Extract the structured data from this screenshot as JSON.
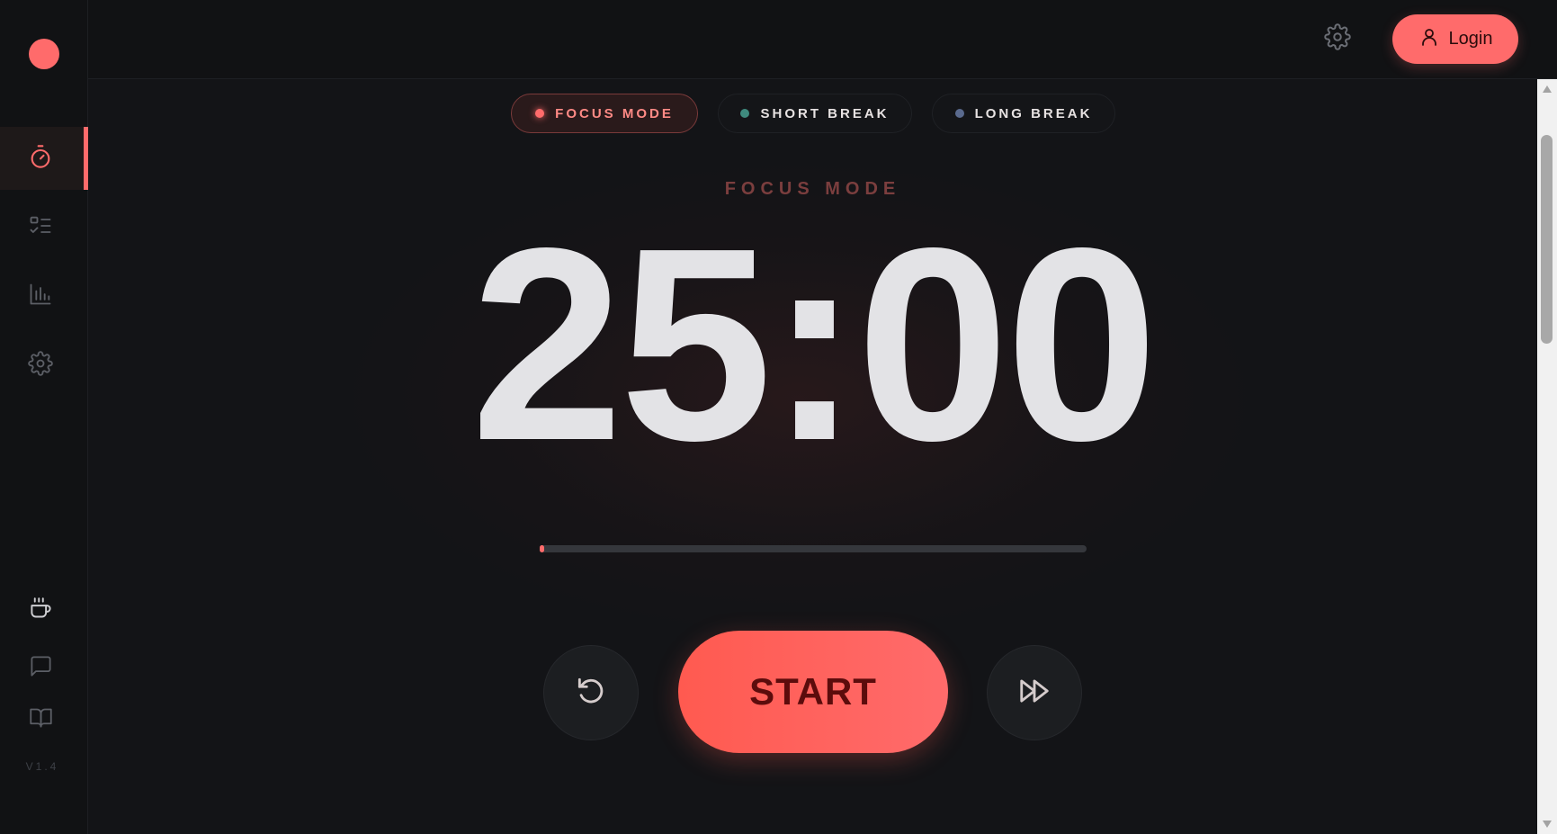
{
  "sidebar": {
    "logo": "app-logo-dot",
    "nav_items": [
      {
        "name": "timer",
        "icon": "stopwatch-icon",
        "active": true
      },
      {
        "name": "tasks",
        "icon": "checklist-icon",
        "active": false
      },
      {
        "name": "stats",
        "icon": "bar-chart-icon",
        "active": false
      },
      {
        "name": "settings",
        "icon": "gear-icon",
        "active": false
      }
    ],
    "bottom_items": [
      {
        "name": "support",
        "icon": "coffee-cup-icon"
      },
      {
        "name": "feedback",
        "icon": "chat-bubble-icon"
      },
      {
        "name": "docs",
        "icon": "book-icon"
      }
    ],
    "version": "V1.4"
  },
  "header": {
    "settings_icon": "gear-icon",
    "login_label": "Login",
    "login_icon": "user-icon"
  },
  "modes": {
    "tabs": [
      {
        "label": "FOCUS MODE",
        "color": "#ff6b6b",
        "active": true
      },
      {
        "label": "SHORT BREAK",
        "color": "#3f8a7e",
        "active": false
      },
      {
        "label": "LONG BREAK",
        "color": "#5a6a8e",
        "active": false
      }
    ]
  },
  "timer": {
    "mode_label": "FOCUS MODE",
    "display": "25:00",
    "progress": 0.009
  },
  "controls": {
    "reset_icon": "reset-icon",
    "start_label": "START",
    "skip_icon": "skip-forward-icon"
  },
  "colors": {
    "accent": "#ff6b6b",
    "background": "#131417",
    "sidebar": "#111214"
  }
}
